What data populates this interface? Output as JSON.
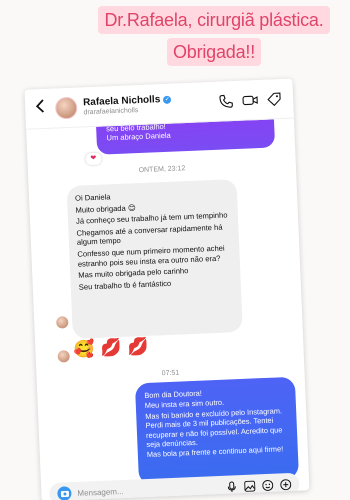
{
  "caption": {
    "line1": "Dr.Rafaela, cirurgiã plástica.",
    "line2": "Obrigada!!"
  },
  "header": {
    "name": "Rafaela Nicholls",
    "username": "drarafaelanicholls",
    "icons": [
      "back-icon",
      "verified-icon",
      "phone-icon",
      "video-icon",
      "tag-icon"
    ]
  },
  "prev_message": {
    "line1": "seu belo trabalho!",
    "line2": "Um abraço Daniela",
    "reaction": "❤"
  },
  "timestamps": {
    "first": "ONTEM, 23:12",
    "second": "07:51"
  },
  "incoming": [
    "Oi Daniela",
    "Muito obrigada 😊",
    "Já conheço seu trabalho já tem um tempinho",
    "Chegamos até a conversar rapidamente há algum tempo",
    "Confesso que num primeiro momento achei estranho pois seu insta era outro não era?",
    "Mas muito obrigada pelo carinho",
    "Seu trabalho tb é fantástico"
  ],
  "emojis": [
    "🥰",
    "💋",
    "💋"
  ],
  "outgoing": [
    "Bom dia Doutora!",
    "Meu insta era sim outro.",
    "Mas foi banido e excluído pelo Instagram. Perdi mais de 3 mil publicações. Tentei recuperar e não foi possível. Acredito que seja denúncias.",
    "Mas bola pra frente e continuo aqui firme!"
  ],
  "composer": {
    "placeholder": "Mensagem..."
  },
  "colors": {
    "caption_bg": "#ffd9df",
    "caption_text": "#e0446a",
    "outgoing": "#4e63f5",
    "prev_outgoing": "#8a3ff4",
    "incoming": "#efefef"
  }
}
